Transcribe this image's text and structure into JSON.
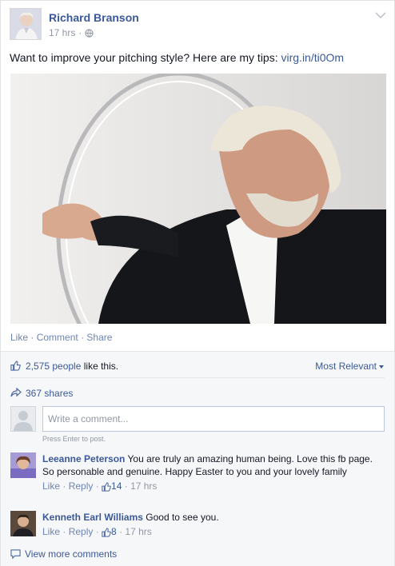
{
  "post": {
    "author": "Richard Branson",
    "time": "17 hrs",
    "text": "Want to improve your pitching style? Here are my tips: ",
    "link": "virg.in/ti0Om"
  },
  "actions": {
    "like": "Like",
    "comment": "Comment",
    "share": "Share"
  },
  "ufi": {
    "likes": "2,575 people",
    "likes_suffix": " like this.",
    "most_relevant": "Most Relevant",
    "shares": "367 shares",
    "comment_placeholder": "Write a comment...",
    "press_enter": "Press Enter to post."
  },
  "comments": [
    {
      "name": "Leeanne Peterson",
      "text": " You are truly an amazing human being. Love this fb page. So personable and genuine. Happy Easter to you and your lovely family",
      "like": "Like",
      "reply": "Reply",
      "likes": "14",
      "time": "17 hrs"
    },
    {
      "name": "Kenneth Earl Williams",
      "text": " Good to see you.",
      "like": "Like",
      "reply": "Reply",
      "likes": "8",
      "time": "17 hrs"
    }
  ],
  "view_more": "View more comments",
  "icons": {
    "globe": "globe-icon",
    "thumbs_up": "thumbs-up-icon",
    "share": "share-icon",
    "chevron": "chevron-down-icon",
    "speech": "speech-bubble-icon"
  },
  "colors": {
    "link_blue": "#3b5998",
    "muted": "#9197a3",
    "ufi_bg": "#f6f7f9"
  }
}
